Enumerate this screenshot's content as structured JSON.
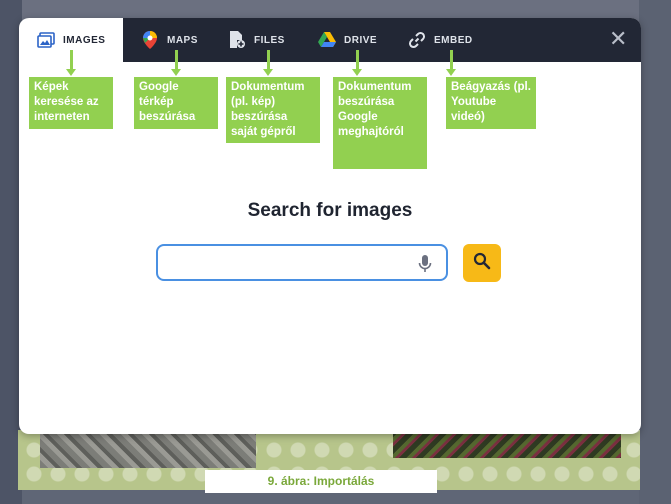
{
  "tabs": [
    {
      "label": "IMAGES",
      "icon": "images-icon",
      "active": true
    },
    {
      "label": "MAPS",
      "icon": "map-pin-icon",
      "active": false
    },
    {
      "label": "FILES",
      "icon": "file-add-icon",
      "active": false
    },
    {
      "label": "DRIVE",
      "icon": "google-drive-icon",
      "active": false
    },
    {
      "label": "EMBED",
      "icon": "link-icon",
      "active": false
    }
  ],
  "close_label": "✕",
  "search": {
    "title": "Search for images",
    "placeholder": ""
  },
  "callouts": [
    {
      "text": "Képek keresése az interneten"
    },
    {
      "text": "Google térkép beszúrása"
    },
    {
      "text": "Dokumentum (pl. kép) beszúrása saját gépről"
    },
    {
      "text": "Dokumentum beszúrása Google meghajtóról"
    },
    {
      "text": "Beágyazás (pl. Youtube videó)"
    }
  ],
  "caption": "9. ábra: Importálás",
  "colors": {
    "tabbar": "#222735",
    "callout": "#92d050",
    "search_button": "#f7b917",
    "search_border": "#4a90e2"
  }
}
